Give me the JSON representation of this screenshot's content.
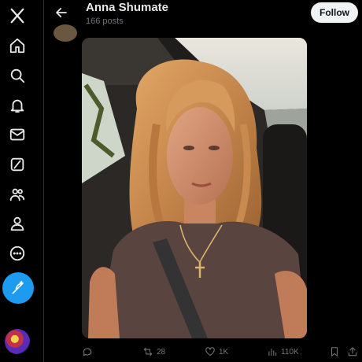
{
  "header": {
    "name": "Anna Shumate",
    "post_count": "166 posts",
    "follow_label": "Follow"
  },
  "nav": {
    "items": [
      {
        "name": "x-logo-icon",
        "label": "X"
      },
      {
        "name": "home-icon",
        "label": "Home"
      },
      {
        "name": "explore-icon",
        "label": "Explore"
      },
      {
        "name": "notifications-icon",
        "label": "Notifications"
      },
      {
        "name": "messages-icon",
        "label": "Messages"
      },
      {
        "name": "grok-icon",
        "label": "Grok"
      },
      {
        "name": "communities-icon",
        "label": "Communities"
      },
      {
        "name": "profile-icon",
        "label": "Profile"
      },
      {
        "name": "more-icon",
        "label": "More"
      }
    ],
    "compose": "compose-post-icon"
  },
  "actions": {
    "reply_count": "",
    "repost_count": "28",
    "like_count": "1K",
    "view_count": "110K"
  },
  "colors": {
    "background": "#000000",
    "accent": "#1d9bf0",
    "muted_text": "#71767b",
    "follow_bg": "#eff3f4"
  }
}
